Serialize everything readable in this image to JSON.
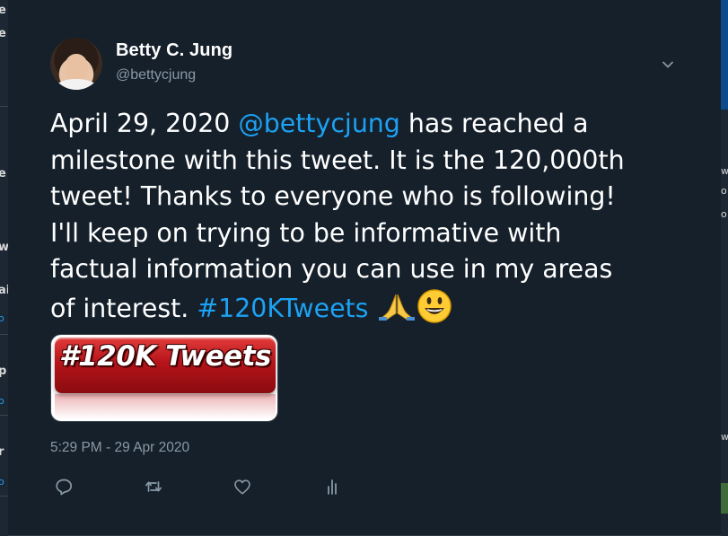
{
  "edge_left": {
    "fragments": [
      "e",
      "e",
      "e",
      "w",
      "ai",
      "o",
      "p",
      "o",
      "r",
      "o"
    ]
  },
  "edge_right": {
    "fragments": [
      "w",
      "o",
      "o",
      "w"
    ]
  },
  "tweet": {
    "author": {
      "display_name": "Betty C. Jung",
      "handle": "@bettycjung"
    },
    "text": {
      "part1": "April 29, 2020  ",
      "mention": "@bettycjung",
      "part2": " has reached a\nmilestone with this tweet. It is the 120,000th\ntweet! Thanks to everyone who is following!\nI'll keep on trying to be informative with\nfactual information you can use in my areas\nof interest.  ",
      "hashtag": "#120KTweets"
    },
    "media": {
      "image_text": "#120K Tweets"
    },
    "timestamp": "5:29 PM - 29 Apr 2020",
    "actions": [
      "reply-icon",
      "retweet-icon",
      "like-icon",
      "analytics-icon"
    ]
  },
  "colors": {
    "background": "#15202b",
    "text": "#ffffff",
    "secondary": "#8899a6",
    "link": "#1da1f2"
  }
}
